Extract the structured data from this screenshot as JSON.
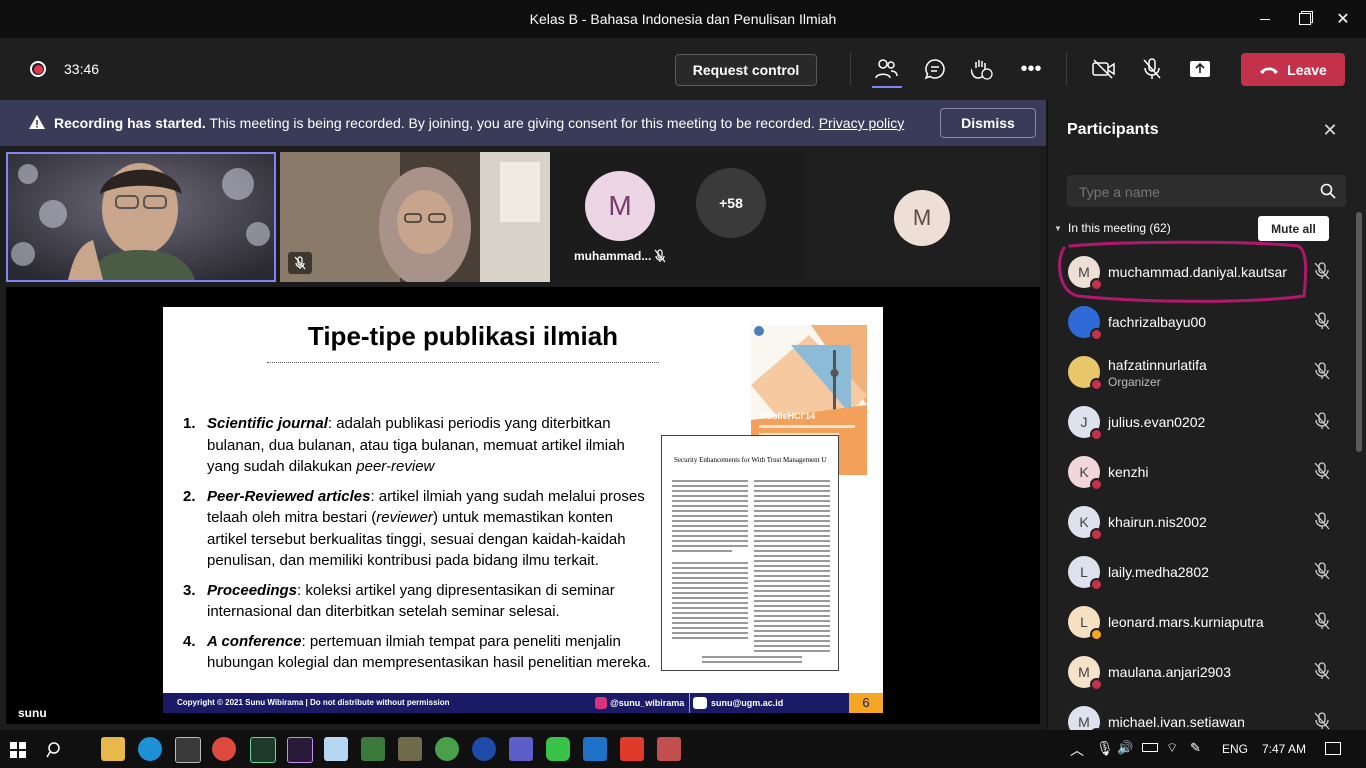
{
  "window": {
    "title": "Kelas B - Bahasa Indonesia dan Penulisan Ilmiah"
  },
  "toolbar": {
    "timer": "33:46",
    "request_control": "Request control",
    "leave": "Leave"
  },
  "banner": {
    "bold": "Recording has started.",
    "text": " This meeting is being recorded. By joining, you are giving consent for this meeting to be recorded. ",
    "link": "Privacy policy",
    "dismiss": "Dismiss"
  },
  "stage": {
    "tile_name": "muhammad...",
    "tile_initial": "M",
    "overflow_count": "+58",
    "tile4_initial": "M",
    "presenter": "sunu"
  },
  "slide": {
    "title": "Tipe-tipe publikasi ilmiah",
    "items": [
      {
        "num": "1.",
        "term": "Scientific journal",
        "text": ": adalah publikasi periodis yang diterbitkan bulanan, dua bulanan, atau tiga bulanan, memuat artikel ilmiah yang sudah dilakukan ",
        "italic_tail": "peer-review"
      },
      {
        "num": "2.",
        "term": "Peer-Reviewed articles",
        "text": ": artikel ilmiah yang sudah melalui proses telaah oleh mitra bestari (",
        "italic_mid": "reviewer",
        "text2": ") untuk memastikan konten artikel tersebut berkualitas tinggi, sesuai dengan kaidah-kaidah penulisan, dan memiliki kontribusi pada bidang ilmu terkait."
      },
      {
        "num": "3.",
        "term": "Proceedings",
        "text": ": koleksi artikel yang dipresentasikan di seminar internasional dan diterbitkan setelah seminar selesai."
      },
      {
        "num": "4.",
        "term": "A conference",
        "text": ": pertemuan ilmiah tempat para peneliti menjalin hubungan kolegial dan mempresentasikan hasil penelitian mereka."
      }
    ],
    "paper_title": "Security Enhancements for With Trust Management U",
    "proc_cover": "MobileHCI'14",
    "footer_copyright": "Copyright © 2021 Sunu Wibirama | Do not distribute without permission",
    "footer_ig": "@sunu_wibirama",
    "footer_email": "sunu@ugm.ac.id",
    "page_number": "6"
  },
  "panel": {
    "title": "Participants",
    "search_placeholder": "Type a name",
    "section": "In this meeting (62)",
    "mute_all": "Mute all",
    "participants": [
      {
        "initial": "M",
        "name": "muchammad.daniyal.kautsar",
        "role": ""
      },
      {
        "initial": "",
        "name": "fachrizalbayu00",
        "role": ""
      },
      {
        "initial": "",
        "name": "hafzatinnurlatifa",
        "role": "Organizer"
      },
      {
        "initial": "J",
        "name": "julius.evan0202",
        "role": ""
      },
      {
        "initial": "K",
        "name": "kenzhi",
        "role": ""
      },
      {
        "initial": "K",
        "name": "khairun.nis2002",
        "role": ""
      },
      {
        "initial": "L",
        "name": "laily.medha2802",
        "role": ""
      },
      {
        "initial": "L",
        "name": "leonard.mars.kurniaputra",
        "role": ""
      },
      {
        "initial": "M",
        "name": "maulana.anjari2903",
        "role": ""
      },
      {
        "initial": "M",
        "name": "michael.ivan.setiawan",
        "role": ""
      }
    ]
  },
  "taskbar": {
    "lang": "ENG",
    "time": "7:47 AM"
  },
  "colors": {
    "leave": "#c4314b",
    "banner": "#3a3b58",
    "annotation": "#b0186e",
    "footer": "#1a1a66"
  }
}
